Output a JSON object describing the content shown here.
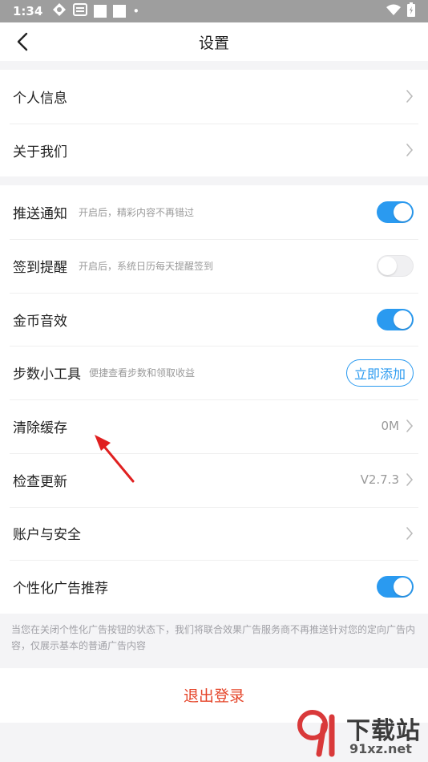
{
  "status_bar": {
    "time": "1:34"
  },
  "header": {
    "title": "设置"
  },
  "group1": [
    {
      "label": "个人信息"
    },
    {
      "label": "关于我们"
    }
  ],
  "group2": {
    "push": {
      "label": "推送通知",
      "hint": "开启后，精彩内容不再错过",
      "enabled": true
    },
    "checkin": {
      "label": "签到提醒",
      "hint": "开启后，系统日历每天提醒签到",
      "enabled": false
    },
    "coin_sound": {
      "label": "金币音效",
      "enabled": true
    },
    "step_tool": {
      "label": "步数小工具",
      "hint": "便捷查看步数和领取收益",
      "button": "立即添加"
    },
    "cache": {
      "label": "清除缓存",
      "value": "0M"
    },
    "update": {
      "label": "检查更新",
      "value": "V2.7.3"
    },
    "account": {
      "label": "账户与安全"
    },
    "ad": {
      "label": "个性化广告推荐",
      "enabled": true
    }
  },
  "notice": "当您在关闭个性化广告按钮的状态下，我们将联合效果广告服务商不再推送针对您的定向广告内容，仅展示基本的普通广告内容",
  "logout_label": "退出登录",
  "watermark": {
    "brand": "下载站",
    "url": "91xz.net"
  },
  "colors": {
    "accent": "#2a9af0",
    "danger": "#e5452a",
    "annotation": "#e02020"
  }
}
